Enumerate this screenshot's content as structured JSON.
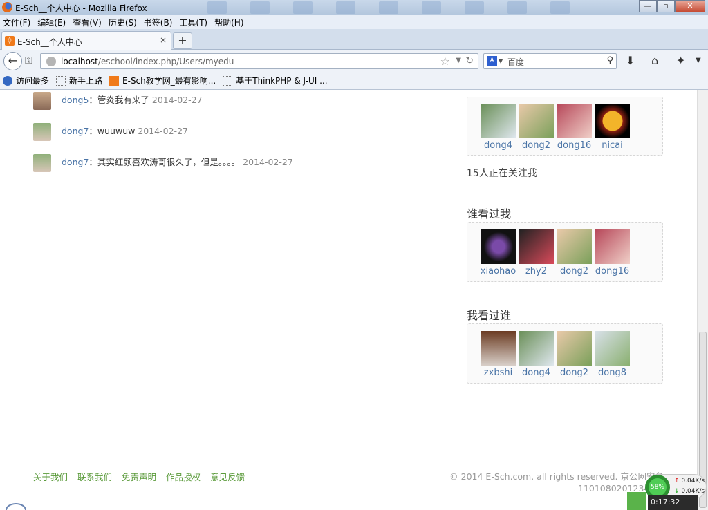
{
  "window": {
    "title": "E-Sch__个人中心 - Mozilla Firefox",
    "btn_min": "—",
    "btn_max": "▫",
    "btn_close": "✕"
  },
  "menu": [
    "文件(F)",
    "编辑(E)",
    "查看(V)",
    "历史(S)",
    "书签(B)",
    "工具(T)",
    "帮助(H)"
  ],
  "tab": {
    "label": "E-Sch__个人中心",
    "close": "×",
    "new": "+"
  },
  "nav": {
    "url_host": "localhost",
    "url_path": "/eschool/index.php/Users/myedu",
    "search_placeholder": "百度"
  },
  "bookmarks": [
    "访问最多",
    "新手上路",
    "E-Sch教学网_最有影响...",
    "基于ThinkPHP & J-UI ..."
  ],
  "comments": [
    {
      "user": "dong5",
      "text": "：管炎我有来了",
      "date": "2014-02-27"
    },
    {
      "user": "dong7",
      "text": "：wuuwuw",
      "date": "2014-02-27"
    },
    {
      "user": "dong7",
      "text": "：其实红颜喜欢涛哥很久了，但是。。。。",
      "date": "2014-02-27"
    }
  ],
  "following": {
    "users": [
      "dong4",
      "dong2",
      "dong16",
      "nicai"
    ],
    "count_text": "15人正在关注我"
  },
  "visitors": {
    "title": "谁看过我",
    "users": [
      "xiaohao",
      "zhy2",
      "dong2",
      "dong16"
    ]
  },
  "visited": {
    "title": "我看过谁",
    "users": [
      "zxbshi",
      "dong4",
      "dong2",
      "dong8"
    ]
  },
  "footer": {
    "links": [
      "关于我们",
      "联系我们",
      "免责声明",
      "作品授权",
      "意见反馈"
    ],
    "copyright": "© 2014 E-Sch.com. all rights reserved. 京公网安备",
    "icp": "1101080201234"
  },
  "net_widget": {
    "percent": "58%",
    "up": "0.04K/s",
    "down": "0.04K/s"
  },
  "corner_clock": "0:17:32",
  "colors": {
    "link": "#4a74a6",
    "footer_link": "#5a9a3a",
    "tab_icon": "#f07a1a"
  }
}
